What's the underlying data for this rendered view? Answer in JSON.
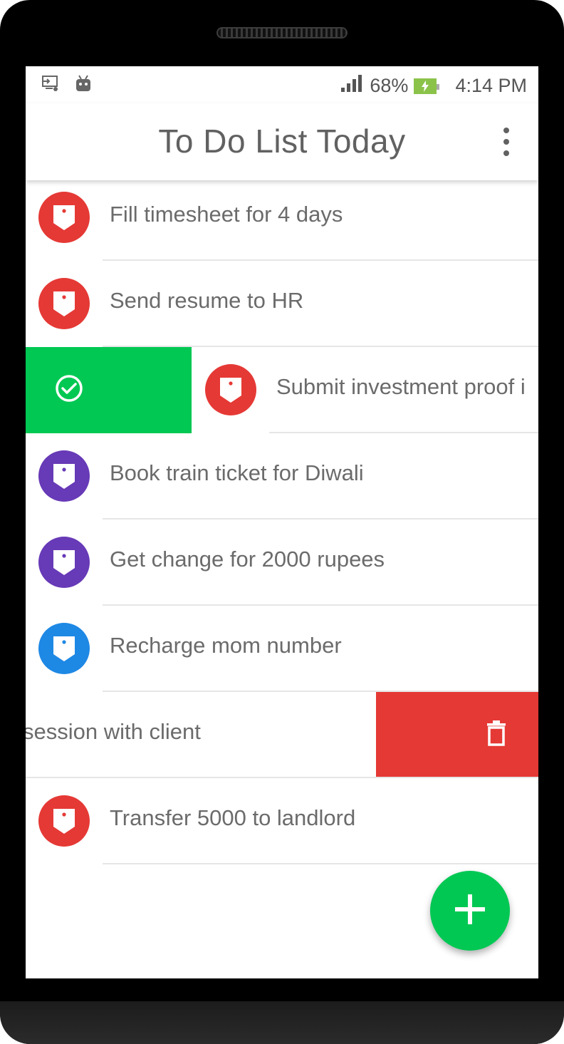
{
  "status_bar": {
    "battery_percent": "68%",
    "time": "4:14 PM",
    "icons": [
      "cast-icon",
      "android-icon",
      "signal-icon",
      "battery-charging-icon"
    ]
  },
  "app_bar": {
    "title": "To Do List Today",
    "menu_icon": "overflow-menu-icon"
  },
  "colors": {
    "red": "#e53935",
    "purple": "#673ab7",
    "blue": "#1e88e5",
    "green": "#00c853"
  },
  "tasks": [
    {
      "text": "Fill timesheet for 4 days",
      "tag_color": "#e53935"
    },
    {
      "text": "Send resume to HR",
      "tag_color": "#e53935"
    },
    {
      "text": "Submit investment proof i",
      "tag_color": "#e53935",
      "swipe": "complete"
    },
    {
      "text": "Book train ticket for Diwali",
      "tag_color": "#673ab7"
    },
    {
      "text": "Get change for 2000 rupees",
      "tag_color": "#673ab7"
    },
    {
      "text": "Recharge mom number",
      "tag_color": "#1e88e5"
    },
    {
      "text": "session with client",
      "swipe": "delete"
    },
    {
      "text": "Transfer 5000 to landlord",
      "tag_color": "#e53935"
    }
  ],
  "fab": {
    "icon": "add-icon"
  }
}
